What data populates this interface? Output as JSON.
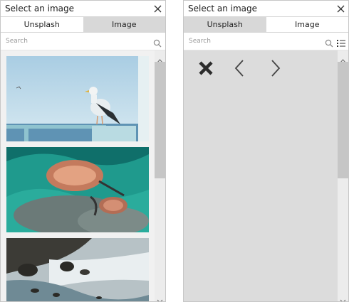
{
  "left": {
    "title": "Select an image",
    "tabs": [
      {
        "label": "Unsplash",
        "active": true
      },
      {
        "label": "Image",
        "active": false
      }
    ],
    "search": {
      "placeholder": "Search",
      "value": ""
    },
    "images": [
      {
        "subject": "seagull on railing"
      },
      {
        "subject": "sunglasses underwater"
      },
      {
        "subject": "rocky coastline waves"
      }
    ]
  },
  "right": {
    "title": "Select an image",
    "tabs": [
      {
        "label": "Unsplash",
        "active": false
      },
      {
        "label": "Image",
        "active": true
      }
    ],
    "search": {
      "placeholder": "Search",
      "value": ""
    },
    "toolbar_icons": [
      "close-x-icon",
      "chevron-left-icon",
      "chevron-right-icon"
    ]
  },
  "colors": {
    "inactive_tab": "#d8d8d8",
    "content_bg_right": "#dcdcdc",
    "scroll_thumb": "#c6c6c6"
  }
}
